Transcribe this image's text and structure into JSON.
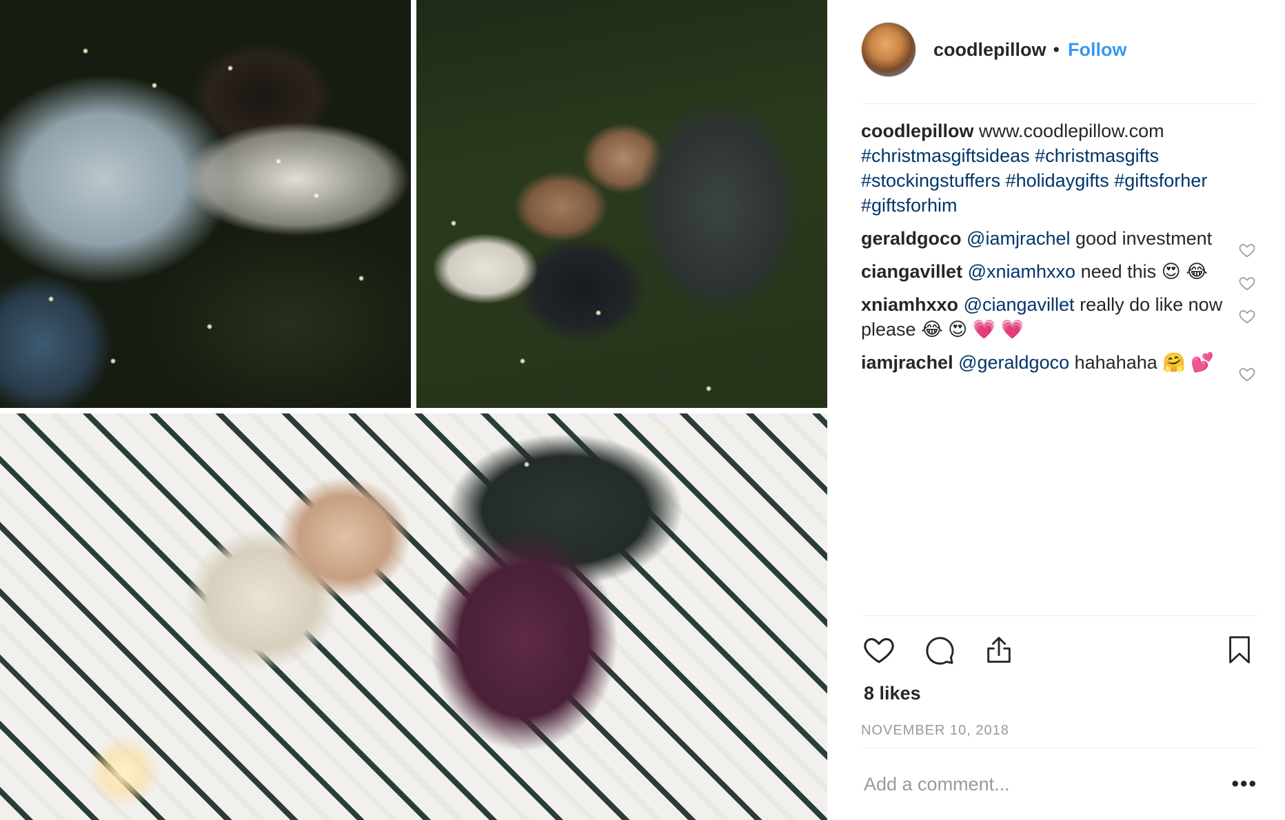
{
  "post": {
    "username": "coodlepillow",
    "dot": "•",
    "follow_label": "Follow",
    "media_alt": "Photo collage of people sleeping on pillows"
  },
  "caption": {
    "username": "coodlepillow",
    "text": "www.coodlepillow.com",
    "hashtags": [
      "#christmasgiftsideas",
      "#christmasgifts",
      "#stockingstuffers",
      "#holidaygifts",
      "#giftsforher",
      "#giftsforhim"
    ]
  },
  "comments": [
    {
      "username": "geraldgoco",
      "mention": "@iamjrachel",
      "text": "good investment"
    },
    {
      "username": "ciangavillet",
      "mention": "@xniamhxxo",
      "text": "need this 😍 😂"
    },
    {
      "username": "xniamhxxo",
      "mention": "@ciangavillet",
      "text": "really do like now please 😂 😍 💗 💗"
    },
    {
      "username": "iamjrachel",
      "mention": "@geraldgoco",
      "text": "hahahaha 🤗 💕"
    }
  ],
  "likes": {
    "count": "8",
    "label": "likes"
  },
  "date": "NOVEMBER 10, 2018",
  "comment_box": {
    "placeholder": "Add a comment..."
  },
  "more_label": "•••",
  "icons": {
    "like": "heart-icon",
    "comment": "comment-icon",
    "share": "share-icon",
    "save": "bookmark-icon",
    "comment_like": "heart-icon"
  },
  "colors": {
    "link": "#3897f0",
    "mention": "#003569",
    "text": "#262626",
    "muted": "#999999",
    "divider": "#efefef"
  }
}
